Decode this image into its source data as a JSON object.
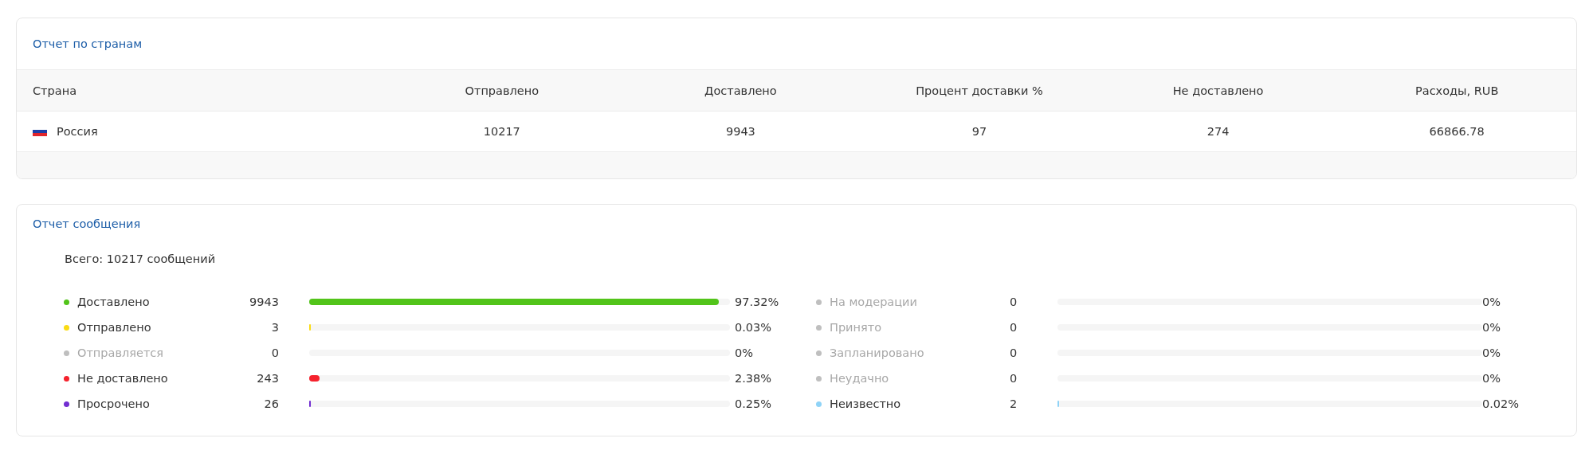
{
  "country_report": {
    "title": "Отчет по странам",
    "table": {
      "columns": [
        "Страна",
        "Отправлено",
        "Доставлено",
        "Процент доставки %",
        "Не доставлено",
        "Расходы, RUB"
      ],
      "rows": [
        {
          "cells": [
            "Россия",
            "10217",
            "9943",
            "97",
            "274",
            "66866.78"
          ]
        }
      ]
    }
  },
  "message_report": {
    "title": "Отчет сообщения",
    "total": "Всего: 10217 сообщений",
    "columns": [
      [
        {
          "label": "Доставлено",
          "count": "9943",
          "level": 0.9732,
          "percent": "97.32%",
          "color": "#52c41a",
          "muted": false
        },
        {
          "label": "Отправлено",
          "count": "3",
          "level": 0.0003,
          "percent": "0.03%",
          "color": "#fadb14",
          "muted": false
        },
        {
          "label": "Отправляется",
          "count": "0",
          "level": 0,
          "percent": "0%",
          "color": "#bfbfbf",
          "muted": true
        },
        {
          "label": "Не доставлено",
          "count": "243",
          "level": 0.0238,
          "percent": "2.38%",
          "color": "#f5222d",
          "muted": false
        },
        {
          "label": "Просрочено",
          "count": "26",
          "level": 0.0025,
          "percent": "0.25%",
          "color": "#722ed1",
          "muted": false
        }
      ],
      [
        {
          "label": "На модерации",
          "count": "0",
          "level": 0,
          "percent": "0%",
          "color": "#bfbfbf",
          "muted": true
        },
        {
          "label": "Принято",
          "count": "0",
          "level": 0,
          "percent": "0%",
          "color": "#bfbfbf",
          "muted": true
        },
        {
          "label": "Запланировано",
          "count": "0",
          "level": 0,
          "percent": "0%",
          "color": "#bfbfbf",
          "muted": true
        },
        {
          "label": "Неудачно",
          "count": "0",
          "level": 0,
          "percent": "0%",
          "color": "#bfbfbf",
          "muted": true
        },
        {
          "label": "Неизвестно",
          "count": "2",
          "level": 0.0002,
          "percent": "0.02%",
          "color": "#8fd3f7",
          "muted": false
        }
      ]
    ]
  }
}
